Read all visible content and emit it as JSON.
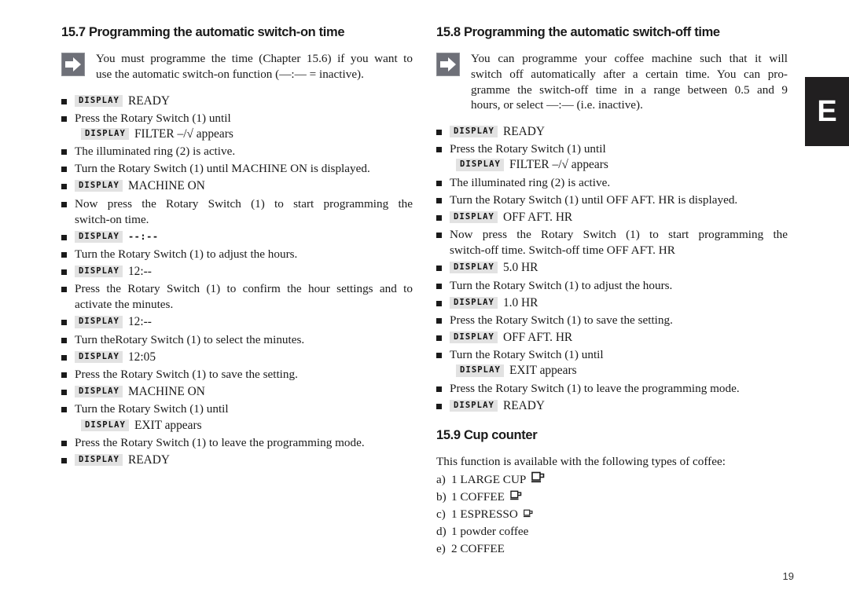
{
  "page": {
    "number": "19",
    "side_tab_letter": "E"
  },
  "left_column": {
    "heading": "15.7 Programming the automatic switch-on time",
    "note": {
      "icon": "arrow-right-icon",
      "line1": "You must programme the time (Chapter 15.6) if you want to",
      "line2": "use the automatic switch-on function (—:— = inactive)."
    },
    "steps": [
      {
        "type": "display",
        "badge": "DISPLAY",
        "value": "READY",
        "pixel": false
      },
      {
        "type": "text-display",
        "text": "Press the Rotary Switch (1) until",
        "badge": "DISPLAY",
        "value": "FILTER –/√ appears",
        "pixel": false
      },
      {
        "type": "text",
        "text": "The illuminated ring (2) is active."
      },
      {
        "type": "text",
        "text": "Turn the Rotary Switch (1) until MACHINE ON is displayed."
      },
      {
        "type": "display",
        "badge": "DISPLAY",
        "value": "MACHINE ON",
        "pixel": false
      },
      {
        "type": "text2",
        "line1": "Now press the Rotary Switch (1) to start programming the",
        "line2": "switch-on time."
      },
      {
        "type": "display",
        "badge": "DISPLAY",
        "value": "--:--",
        "pixel": true
      },
      {
        "type": "text",
        "text": "Turn the Rotary Switch (1) to adjust the hours."
      },
      {
        "type": "display",
        "badge": "DISPLAY",
        "value": "12:--",
        "pixel": false
      },
      {
        "type": "text2",
        "line1": "Press the Rotary Switch (1) to confirm the hour settings and to",
        "line2": "activate the minutes."
      },
      {
        "type": "display",
        "badge": "DISPLAY",
        "value": "12:--",
        "pixel": false
      },
      {
        "type": "text",
        "text": "Turn theRotary Switch (1) to select the minutes."
      },
      {
        "type": "display",
        "badge": "DISPLAY",
        "value": "12:05",
        "pixel": false
      },
      {
        "type": "text",
        "text": "Press the Rotary Switch (1) to save the setting."
      },
      {
        "type": "display",
        "badge": "DISPLAY",
        "value": "MACHINE ON",
        "pixel": false
      },
      {
        "type": "text-display",
        "text": "Turn the Rotary Switch (1) until",
        "badge": "DISPLAY",
        "value": "EXIT appears",
        "pixel": false
      },
      {
        "type": "text",
        "text": "Press the Rotary Switch (1) to leave the programming mode."
      },
      {
        "type": "display",
        "badge": "DISPLAY",
        "value": "READY",
        "pixel": false
      }
    ]
  },
  "right_column": {
    "heading": "15.8 Programming the automatic switch-off time",
    "note": {
      "icon": "arrow-right-icon",
      "line1": "You can programme your coffee machine such that it will",
      "line2": "switch off automatically after a certain time. You can pro-",
      "line3": "gramme the switch-off time in a range between 0.5 and 9",
      "line4": "hours, or select —:— (i.e. inactive)."
    },
    "steps": [
      {
        "type": "display",
        "badge": "DISPLAY",
        "value": "READY",
        "pixel": false
      },
      {
        "type": "text-display",
        "text": "Press the Rotary Switch (1) until",
        "badge": "DISPLAY",
        "value": "FILTER –/√ appears",
        "pixel": false
      },
      {
        "type": "text",
        "text": "The illuminated ring (2) is active."
      },
      {
        "type": "text",
        "text": "Turn the Rotary Switch (1) until OFF AFT. HR is displayed."
      },
      {
        "type": "display",
        "badge": "DISPLAY",
        "value": "OFF AFT. HR",
        "pixel": false
      },
      {
        "type": "text2",
        "line1": "Now press the Rotary Switch (1) to start programming the",
        "line2": "switch-off time. Switch-off time OFF AFT. HR"
      },
      {
        "type": "display",
        "badge": "DISPLAY",
        "value": "5.0 HR",
        "pixel": false
      },
      {
        "type": "text",
        "text": "Turn the Rotary Switch (1) to adjust the hours."
      },
      {
        "type": "display",
        "badge": "DISPLAY",
        "value": "1.0 HR",
        "pixel": false
      },
      {
        "type": "text",
        "text": "Press the Rotary Switch (1) to save the setting."
      },
      {
        "type": "display",
        "badge": "DISPLAY",
        "value": "OFF AFT. HR",
        "pixel": false
      },
      {
        "type": "text-display",
        "text": "Turn the Rotary Switch (1) until",
        "badge": "DISPLAY",
        "value": "EXIT appears",
        "pixel": false
      },
      {
        "type": "text",
        "text": "Press the Rotary Switch (1) to leave the programming mode."
      },
      {
        "type": "display",
        "badge": "DISPLAY",
        "value": "READY",
        "pixel": false
      }
    ],
    "cup_counter": {
      "heading": "15.9 Cup counter",
      "intro": "This function is available with the following types of coffee:",
      "items": [
        {
          "marker": "a)",
          "label": "1 LARGE CUP",
          "icon": "large-cup-icon",
          "icon_size": "large"
        },
        {
          "marker": "b)",
          "label": "1 COFFEE",
          "icon": "coffee-cup-icon",
          "icon_size": "medium"
        },
        {
          "marker": "c)",
          "label": "1 ESPRESSO",
          "icon": "espresso-cup-icon",
          "icon_size": "small"
        },
        {
          "marker": "d)",
          "label": "1 powder coffee",
          "icon": null,
          "icon_size": null
        },
        {
          "marker": "e)",
          "label": "2 COFFEE",
          "icon": null,
          "icon_size": null
        }
      ]
    }
  },
  "colors": {
    "text": "#1a1a1a",
    "side_tab_bg": "#211f20",
    "display_badge_bg": "#e2e2e2",
    "note_icon_bg": "#6e7078"
  }
}
